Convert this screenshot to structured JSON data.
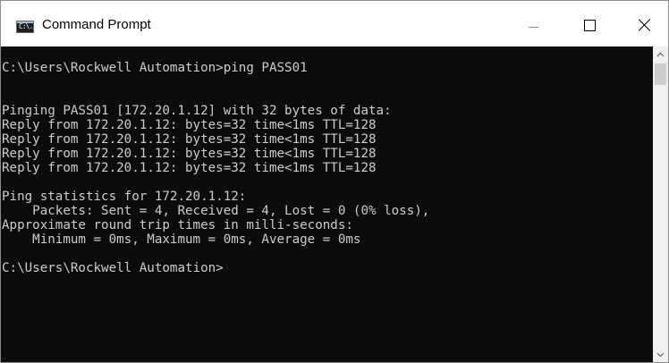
{
  "window": {
    "title": "Command Prompt",
    "icon": "console-app-icon",
    "icon_label": "C:\\."
  },
  "controls": {
    "minimize": "minimize-icon",
    "maximize": "maximize-icon",
    "close": "close-icon"
  },
  "console": {
    "lines": [
      "C:\\Users\\Rockwell Automation>ping PASS01",
      "Pinging PASS01 [172.20.1.12] with 32 bytes of data:",
      "Reply from 172.20.1.12: bytes=32 time<1ms TTL=128",
      "Reply from 172.20.1.12: bytes=32 time<1ms TTL=128",
      "Reply from 172.20.1.12: bytes=32 time<1ms TTL=128",
      "Reply from 172.20.1.12: bytes=32 time<1ms TTL=128",
      "Ping statistics for 172.20.1.12:",
      "    Packets: Sent = 4, Received = 4, Lost = 0 (0% loss),",
      "Approximate round trip times in milli-seconds:",
      "    Minimum = 0ms, Maximum = 0ms, Average = 0ms",
      "C:\\Users\\Rockwell Automation>"
    ]
  },
  "colors": {
    "console_bg": "#0c0c0c",
    "console_text": "#cccccc",
    "titlebar_bg": "#ffffff"
  }
}
